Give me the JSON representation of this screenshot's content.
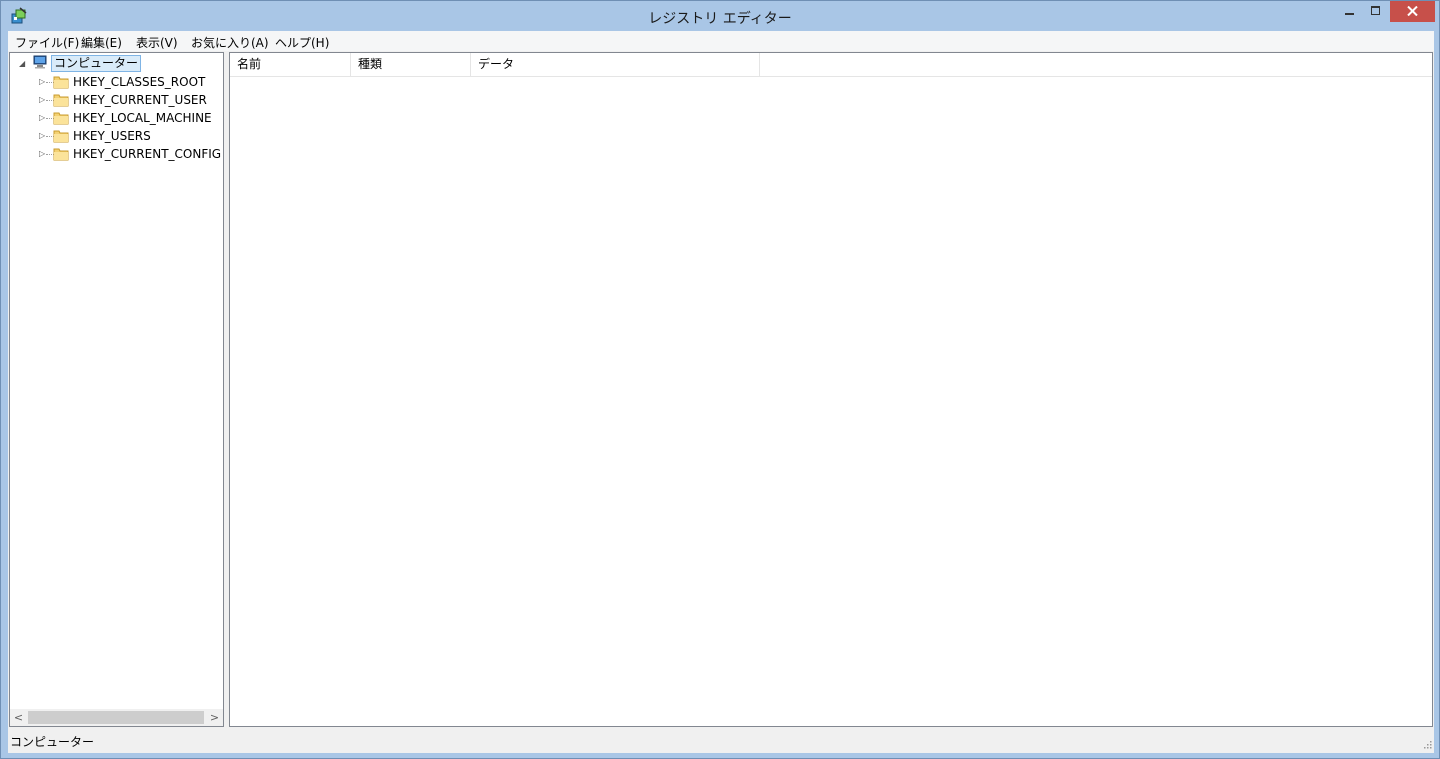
{
  "window": {
    "title": "レジストリ エディター",
    "icons": {
      "app": "registry-editor-icon",
      "minimize": "minimize-icon",
      "maximize": "maximize-icon",
      "close": "close-icon"
    }
  },
  "menu": {
    "file": "ファイル(F)",
    "edit": "編集(E)",
    "view": "表示(V)",
    "favorites": "お気に入り(A)",
    "help": "ヘルプ(H)"
  },
  "tree": {
    "root": {
      "label": "コンピューター",
      "icon": "computer-icon",
      "expanded": true,
      "selected": true
    },
    "items": [
      {
        "label": "HKEY_CLASSES_ROOT",
        "icon": "folder-icon"
      },
      {
        "label": "HKEY_CURRENT_USER",
        "icon": "folder-icon"
      },
      {
        "label": "HKEY_LOCAL_MACHINE",
        "icon": "folder-icon"
      },
      {
        "label": "HKEY_USERS",
        "icon": "folder-icon"
      },
      {
        "label": "HKEY_CURRENT_CONFIG",
        "icon": "folder-icon"
      }
    ]
  },
  "list": {
    "columns": [
      "名前",
      "種類",
      "データ"
    ],
    "rows": []
  },
  "status": {
    "path": "コンピューター"
  },
  "colors": {
    "frame": "#a9c6e6",
    "close_button": "#c7504a",
    "selection": "#d9ebf9"
  }
}
